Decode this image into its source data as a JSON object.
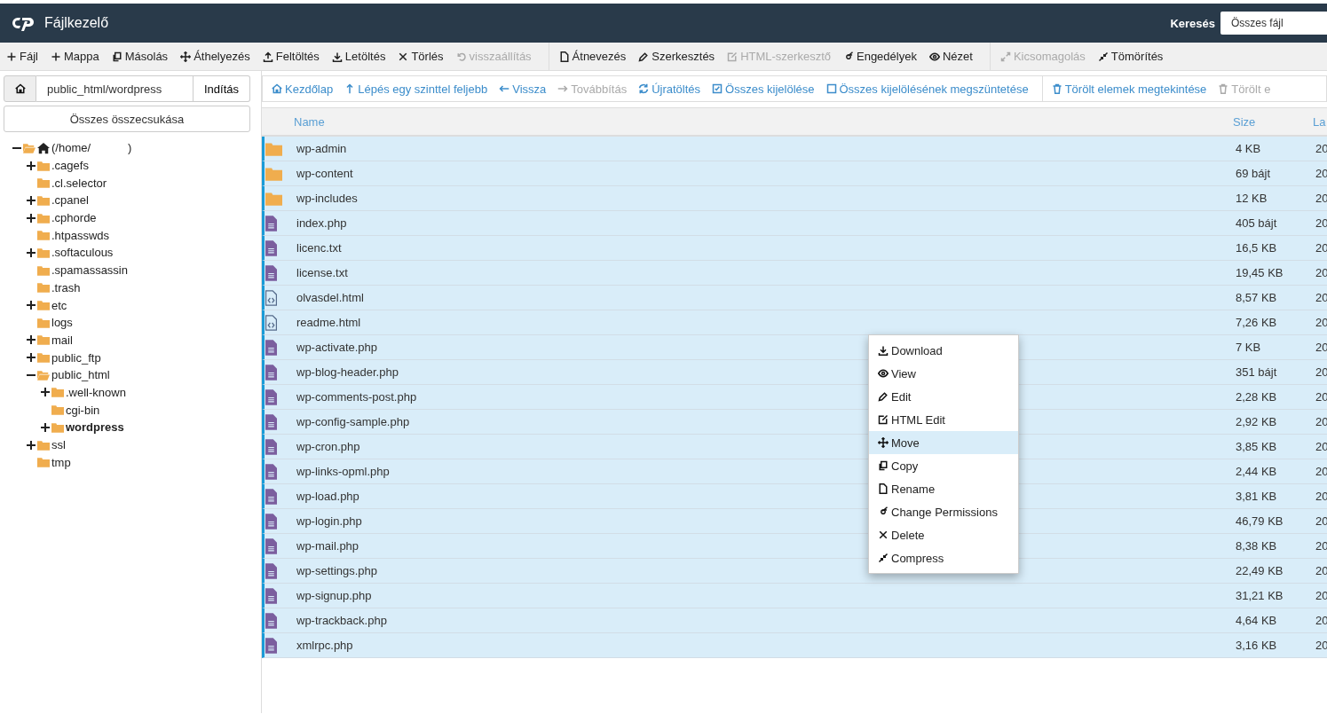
{
  "header": {
    "title": "Fájlkezelő",
    "search_label": "Keresés",
    "search_value": "Összes fájl"
  },
  "toolbar": [
    [
      {
        "label": "Fájl",
        "disabled": false
      },
      {
        "label": "Mappa",
        "disabled": false
      },
      {
        "label": "Másolás",
        "disabled": false
      },
      {
        "label": "Áthelyezés",
        "disabled": false
      },
      {
        "label": "Feltöltés",
        "disabled": false
      },
      {
        "label": "Letöltés",
        "disabled": false
      },
      {
        "label": "Törlés",
        "disabled": false
      },
      {
        "label": "visszaállítás",
        "disabled": true
      }
    ],
    [
      {
        "label": "Átnevezés",
        "disabled": false
      },
      {
        "label": "Szerkesztés",
        "disabled": false
      },
      {
        "label": "HTML-szerkesztő",
        "disabled": true
      },
      {
        "label": "Engedélyek",
        "disabled": false
      },
      {
        "label": "Nézet",
        "disabled": false
      }
    ],
    [
      {
        "label": "Kicsomagolás",
        "disabled": true
      },
      {
        "label": "Tömörítés",
        "disabled": false
      }
    ]
  ],
  "path_bar": {
    "value": "public_html/wordpress",
    "go_button": "Indítás"
  },
  "collapse_all": "Összes összecsukása",
  "tree": [
    {
      "label": "(/home/",
      "label_end": ")",
      "expandable": true,
      "expanded": true,
      "selected": false,
      "children": [
        {
          "label": ".cagefs",
          "expandable": true,
          "expanded": false,
          "selected": false
        },
        {
          "label": ".cl.selector",
          "expandable": false,
          "expanded": false,
          "selected": false
        },
        {
          "label": ".cpanel",
          "expandable": true,
          "expanded": false,
          "selected": false
        },
        {
          "label": ".cphorde",
          "expandable": true,
          "expanded": false,
          "selected": false
        },
        {
          "label": ".htpasswds",
          "expandable": false,
          "expanded": false,
          "selected": false
        },
        {
          "label": ".softaculous",
          "expandable": true,
          "expanded": false,
          "selected": false
        },
        {
          "label": ".spamassassin",
          "expandable": false,
          "expanded": false,
          "selected": false
        },
        {
          "label": ".trash",
          "expandable": false,
          "expanded": false,
          "selected": false
        },
        {
          "label": "etc",
          "expandable": true,
          "expanded": false,
          "selected": false
        },
        {
          "label": "logs",
          "expandable": false,
          "expanded": false,
          "selected": false
        },
        {
          "label": "mail",
          "expandable": true,
          "expanded": false,
          "selected": false
        },
        {
          "label": "public_ftp",
          "expandable": true,
          "expanded": false,
          "selected": false
        },
        {
          "label": "public_html",
          "expandable": true,
          "expanded": true,
          "selected": false,
          "children": [
            {
              "label": ".well-known",
              "expandable": true,
              "expanded": false,
              "selected": false
            },
            {
              "label": "cgi-bin",
              "expandable": false,
              "expanded": false,
              "selected": false
            },
            {
              "label": "wordpress",
              "expandable": true,
              "expanded": false,
              "selected": true
            }
          ]
        },
        {
          "label": "ssl",
          "expandable": true,
          "expanded": false,
          "selected": false
        },
        {
          "label": "tmp",
          "expandable": false,
          "expanded": false,
          "selected": false
        }
      ]
    }
  ],
  "nav_bar": [
    [
      {
        "label": "Kezdőlap",
        "disabled": false
      },
      {
        "label": "Lépés egy szinttel feljebb",
        "disabled": false
      },
      {
        "label": "Vissza",
        "disabled": false
      },
      {
        "label": "Továbbítás",
        "disabled": true
      },
      {
        "label": "Újratöltés",
        "disabled": false
      },
      {
        "label": "Összes kijelölése",
        "disabled": false
      },
      {
        "label": "Összes kijelölésének megszüntetése",
        "disabled": false
      }
    ],
    [
      {
        "label": "Törölt elemek megtekintése",
        "disabled": false
      },
      {
        "label": "Törölt e",
        "disabled": true
      }
    ]
  ],
  "table": {
    "columns": [
      "Name",
      "Size",
      "La"
    ],
    "rows": [
      {
        "kind": "folder",
        "name": "wp-admin",
        "size": "4 KB",
        "column_3": "20",
        "selected": true
      },
      {
        "kind": "folder",
        "name": "wp-content",
        "size": "69 bájt",
        "column_3": "20",
        "selected": true
      },
      {
        "kind": "folder",
        "name": "wp-includes",
        "size": "12 KB",
        "column_3": "20",
        "selected": true
      },
      {
        "kind": "file",
        "name": "index.php",
        "size": "405 bájt",
        "column_3": "20",
        "selected": true
      },
      {
        "kind": "file",
        "name": "licenc.txt",
        "size": "16,5 KB",
        "column_3": "20",
        "selected": true
      },
      {
        "kind": "file",
        "name": "license.txt",
        "size": "19,45 KB",
        "column_3": "20",
        "selected": true
      },
      {
        "kind": "html",
        "name": "olvasdel.html",
        "size": "8,57 KB",
        "column_3": "20",
        "selected": true
      },
      {
        "kind": "html",
        "name": "readme.html",
        "size": "7,26 KB",
        "column_3": "20",
        "selected": true
      },
      {
        "kind": "file",
        "name": "wp-activate.php",
        "size": "7 KB",
        "column_3": "20",
        "selected": true
      },
      {
        "kind": "file",
        "name": "wp-blog-header.php",
        "size": "351 bájt",
        "column_3": "20",
        "selected": true
      },
      {
        "kind": "file",
        "name": "wp-comments-post.php",
        "size": "2,28 KB",
        "column_3": "20",
        "selected": true
      },
      {
        "kind": "file",
        "name": "wp-config-sample.php",
        "size": "2,92 KB",
        "column_3": "20",
        "selected": true
      },
      {
        "kind": "file",
        "name": "wp-cron.php",
        "size": "3,85 KB",
        "column_3": "20",
        "selected": true
      },
      {
        "kind": "file",
        "name": "wp-links-opml.php",
        "size": "2,44 KB",
        "column_3": "20",
        "selected": true
      },
      {
        "kind": "file",
        "name": "wp-load.php",
        "size": "3,81 KB",
        "column_3": "20",
        "selected": true
      },
      {
        "kind": "file",
        "name": "wp-login.php",
        "size": "46,79 KB",
        "column_3": "20",
        "selected": true
      },
      {
        "kind": "file",
        "name": "wp-mail.php",
        "size": "8,38 KB",
        "column_3": "20",
        "selected": true
      },
      {
        "kind": "file",
        "name": "wp-settings.php",
        "size": "22,49 KB",
        "column_3": "20",
        "selected": true
      },
      {
        "kind": "file",
        "name": "wp-signup.php",
        "size": "31,21 KB",
        "column_3": "20",
        "selected": true
      },
      {
        "kind": "file",
        "name": "wp-trackback.php",
        "size": "4,64 KB",
        "column_3": "20",
        "selected": true
      },
      {
        "kind": "file",
        "name": "xmlrpc.php",
        "size": "3,16 KB",
        "column_3": "20",
        "selected": true
      }
    ]
  },
  "context_menu": [
    {
      "label": "Download",
      "selected": false
    },
    {
      "label": "View",
      "selected": false
    },
    {
      "label": "Edit",
      "selected": false
    },
    {
      "label": "HTML Edit",
      "selected": false
    },
    {
      "label": "Move",
      "selected": true
    },
    {
      "label": "Copy",
      "selected": false
    },
    {
      "label": "Rename",
      "selected": false
    },
    {
      "label": "Change Permissions",
      "selected": false
    },
    {
      "label": "Delete",
      "selected": false
    },
    {
      "label": "Compress",
      "selected": false
    }
  ]
}
